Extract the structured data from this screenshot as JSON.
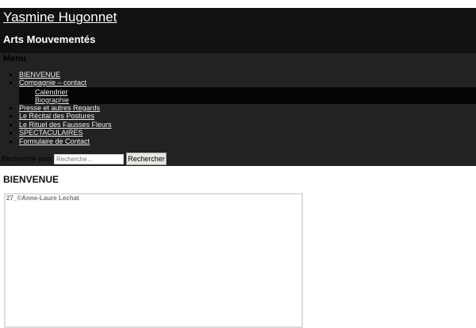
{
  "header": {
    "site_title": "Yasmine Hugonnet",
    "site_description": "Arts Mouvementés"
  },
  "menu": {
    "title": "Menu",
    "items": [
      {
        "label": "BIENVENUE"
      },
      {
        "label": "Compagnie – contact"
      },
      {
        "label": "Presse et autres Regards"
      },
      {
        "label": "Le Récital des Postures"
      },
      {
        "label": "Le Rituel des Fausses Fleurs"
      },
      {
        "label": "SPECTACULAIRES"
      },
      {
        "label": "Formulaire de Contact"
      }
    ],
    "subitems": [
      {
        "label": "Calendrier"
      },
      {
        "label": "Biographie"
      }
    ]
  },
  "search": {
    "label": "Recherche pour :",
    "placeholder": "Recherche…",
    "button": "Rechercher"
  },
  "main": {
    "heading": "BIENVENUE",
    "image_caption": "27_©Anne-Laure Lechat"
  }
}
